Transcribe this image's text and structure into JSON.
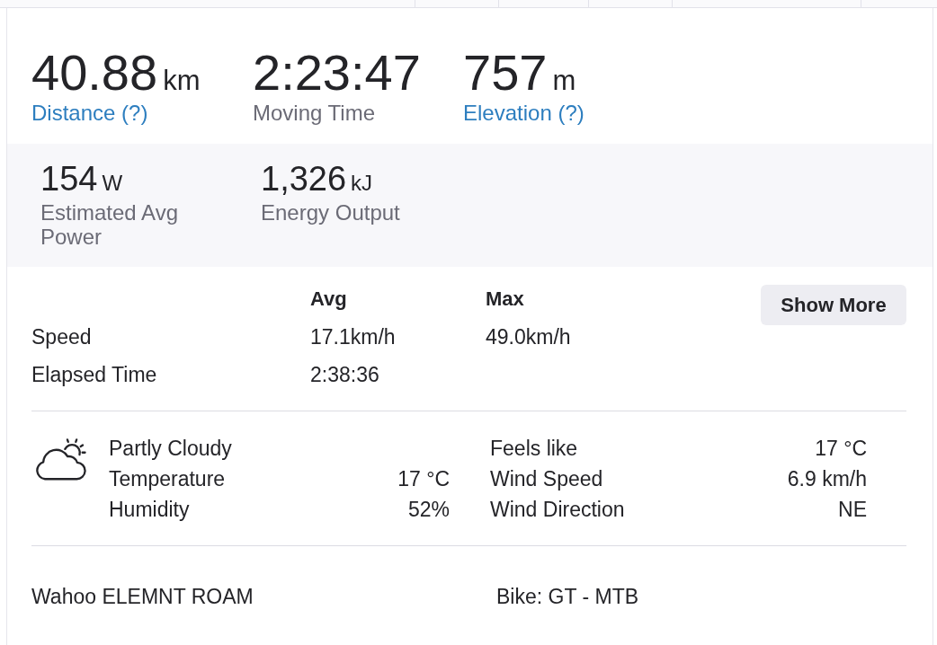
{
  "primary_stats": [
    {
      "value": "40.88",
      "unit": "km",
      "label": "Distance (?)",
      "kind": "link"
    },
    {
      "value": "2:23:47",
      "label": "Moving Time",
      "kind": "text"
    },
    {
      "value": "757",
      "unit": "m",
      "label": "Elevation (?)",
      "kind": "link"
    }
  ],
  "secondary_stats": [
    {
      "value": "154",
      "unit": "W",
      "label": "Estimated Avg Power"
    },
    {
      "value": "1,326",
      "unit": "kJ",
      "label": "Energy Output"
    }
  ],
  "stats_table": {
    "columns": [
      "Avg",
      "Max"
    ],
    "rows": [
      {
        "label": "Speed",
        "values": [
          "17.1km/h",
          "49.0km/h"
        ]
      },
      {
        "label": "Elapsed Time",
        "values": [
          "2:38:36"
        ]
      }
    ]
  },
  "show_more_button": "Show More",
  "weather": {
    "condition": "Partly Cloudy",
    "left": [
      {
        "label": "Temperature",
        "value": "17 °C"
      },
      {
        "label": "Humidity",
        "value": "52%"
      }
    ],
    "right": [
      {
        "label": "Feels like",
        "value": "17 °C"
      },
      {
        "label": "Wind Speed",
        "value": "6.9 km/h"
      },
      {
        "label": "Wind Direction",
        "value": "NE"
      }
    ]
  },
  "device": "Wahoo ELEMNT ROAM",
  "gear": "Bike: GT - MTB"
}
